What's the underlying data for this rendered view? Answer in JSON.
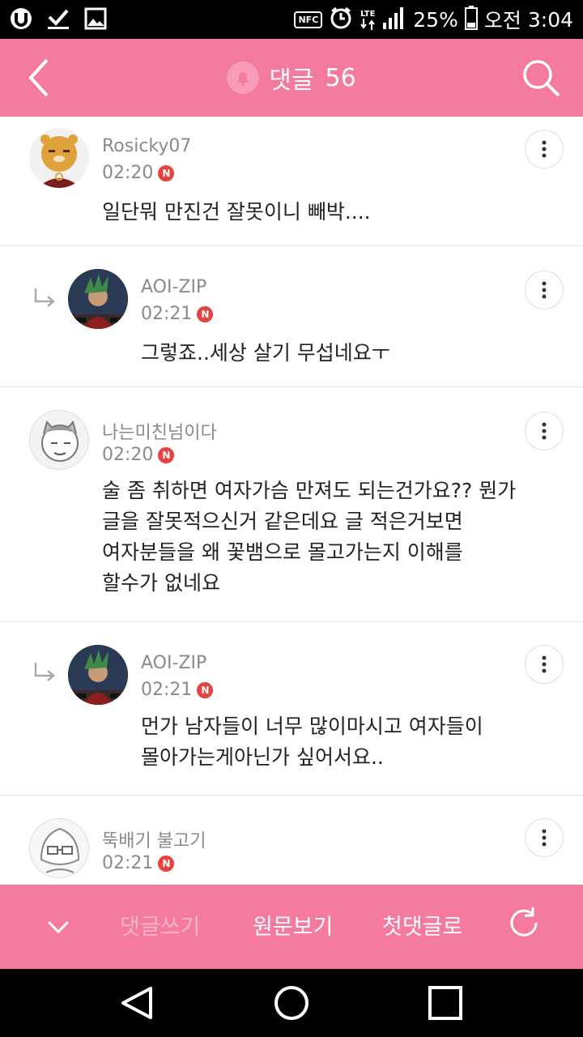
{
  "statusbar": {
    "nfc": "NFC",
    "lte": "LTE",
    "battery": "25%",
    "ampm": "오전",
    "time": "3:04"
  },
  "header": {
    "title": "댓글",
    "count": "56"
  },
  "comments": [
    {
      "name": "Rosicky07",
      "time": "02:20",
      "badge": "N",
      "text": "일단뭐 만진건 잘못이니 빼박....",
      "reply": false
    },
    {
      "name": "AOI-ZIP",
      "time": "02:21",
      "badge": "N",
      "text": "그렇죠..세상 살기 무섭네요ㅜ",
      "reply": true
    },
    {
      "name": "나는미친넘이다",
      "time": "02:20",
      "badge": "N",
      "lines": [
        "술 좀 취하면 여자가슴 만져도 되는건가요?? 뭔가",
        "글을 잘못적으신거 같은데요 글 적은거보면",
        "여자분들을 왜 꽃뱀으로 몰고가는지 이해를",
        "할수가 없네요"
      ],
      "reply": false
    },
    {
      "name": "AOI-ZIP",
      "time": "02:21",
      "badge": "N",
      "lines": [
        "먼가 남자들이 너무 많이마시고 여자들이",
        "몰아가는게아닌가 싶어서요.."
      ],
      "reply": true
    },
    {
      "name": "뚝배기 불고기",
      "time": "02:21",
      "badge": "N",
      "text": "",
      "reply": false
    }
  ],
  "bottombar": {
    "write": "댓글쓰기",
    "original": "원문보기",
    "first": "첫댓글로"
  },
  "icons": {
    "back": "chevron-left-icon",
    "search": "search-icon",
    "bell": "bell-icon",
    "more": "more-vertical-icon",
    "reply": "reply-arrow-icon",
    "collapse": "chevron-down-icon",
    "refresh": "refresh-icon"
  },
  "colors": {
    "accent": "#f47aa0",
    "badge": "#e8413f",
    "text": "#222222",
    "meta": "#8a8a8a"
  }
}
